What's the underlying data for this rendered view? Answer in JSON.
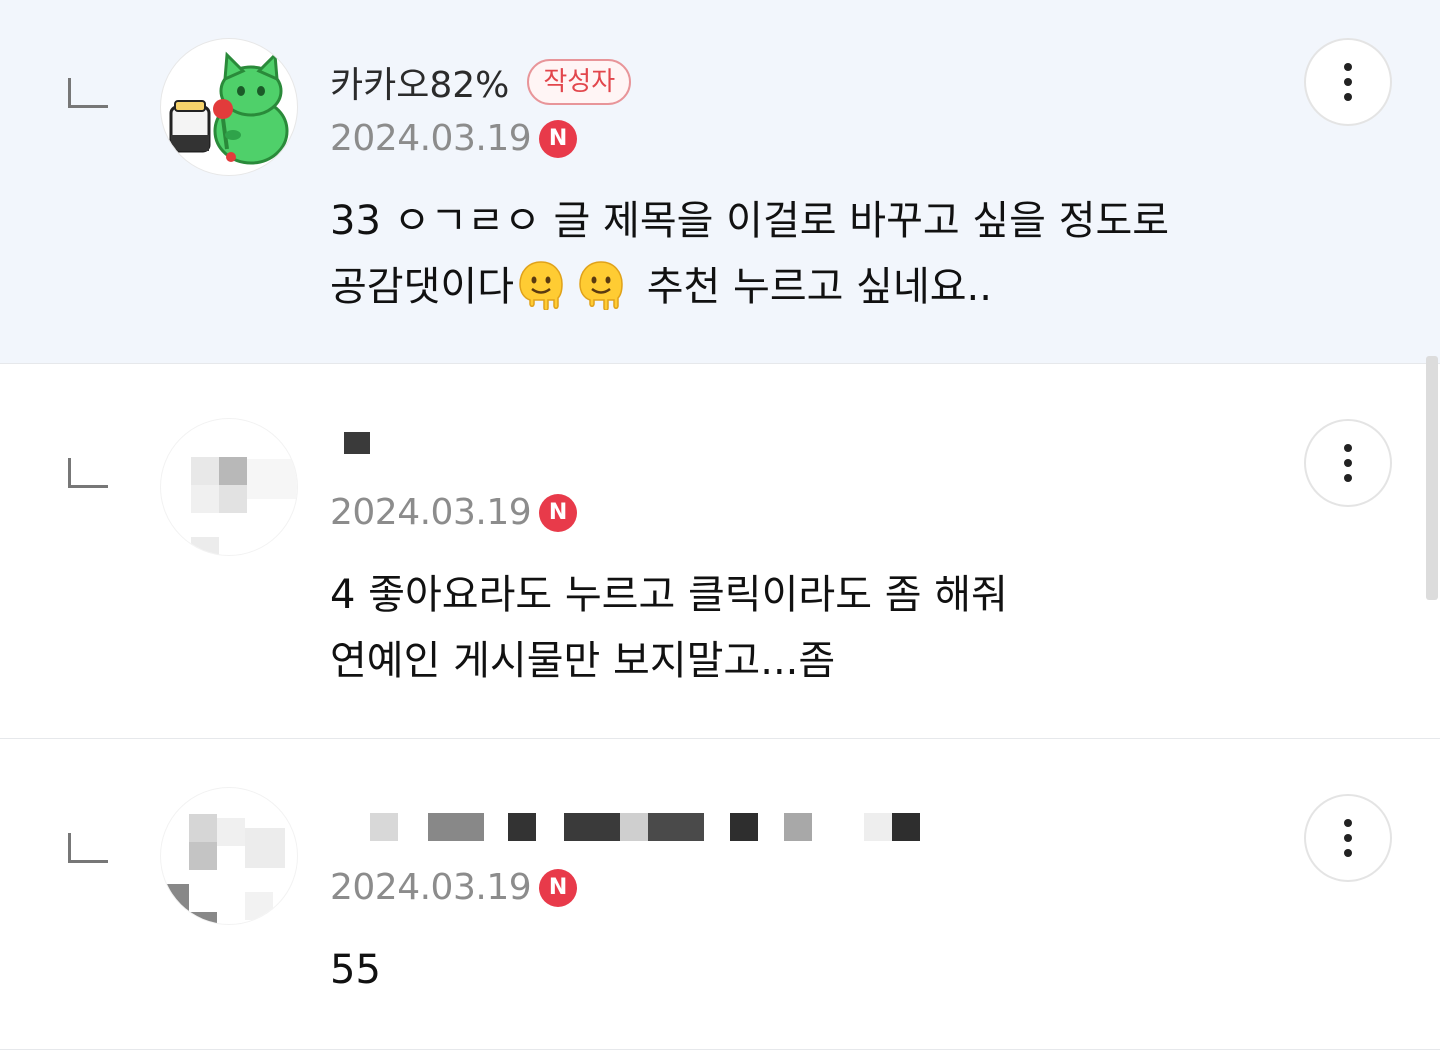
{
  "comments": [
    {
      "name": "카카오82%",
      "author_badge": "작성자",
      "date": "2024.03.19",
      "new_badge": "N",
      "text_line1": "33 ㅇㄱㄹㅇ 글 제목을 이걸로 바꾸고 싶을 정도로",
      "text_line2_a": "공감댓이다",
      "text_line2_b": "추천 누르고 싶네요.."
    },
    {
      "name": "",
      "date": "2024.03.19",
      "new_badge": "N",
      "text_line1": "4 좋아요라도 누르고 클릭이라도 좀 해줘",
      "text_line2": "연예인 게시물만 보지말고...좀"
    },
    {
      "name": "",
      "date": "2024.03.19",
      "new_badge": "N",
      "text_line1": "55"
    }
  ],
  "icons": {
    "reply": "reply-arrow-icon",
    "more": "more-vertical-icon",
    "emoji": "melting-face-emoji",
    "avatar_1": "green-cat-avatar"
  },
  "colors": {
    "highlight_bg": "#f2f6fc",
    "author_badge": "#e2464c",
    "new_badge": "#e83a4a",
    "date": "#8c8c8c"
  }
}
